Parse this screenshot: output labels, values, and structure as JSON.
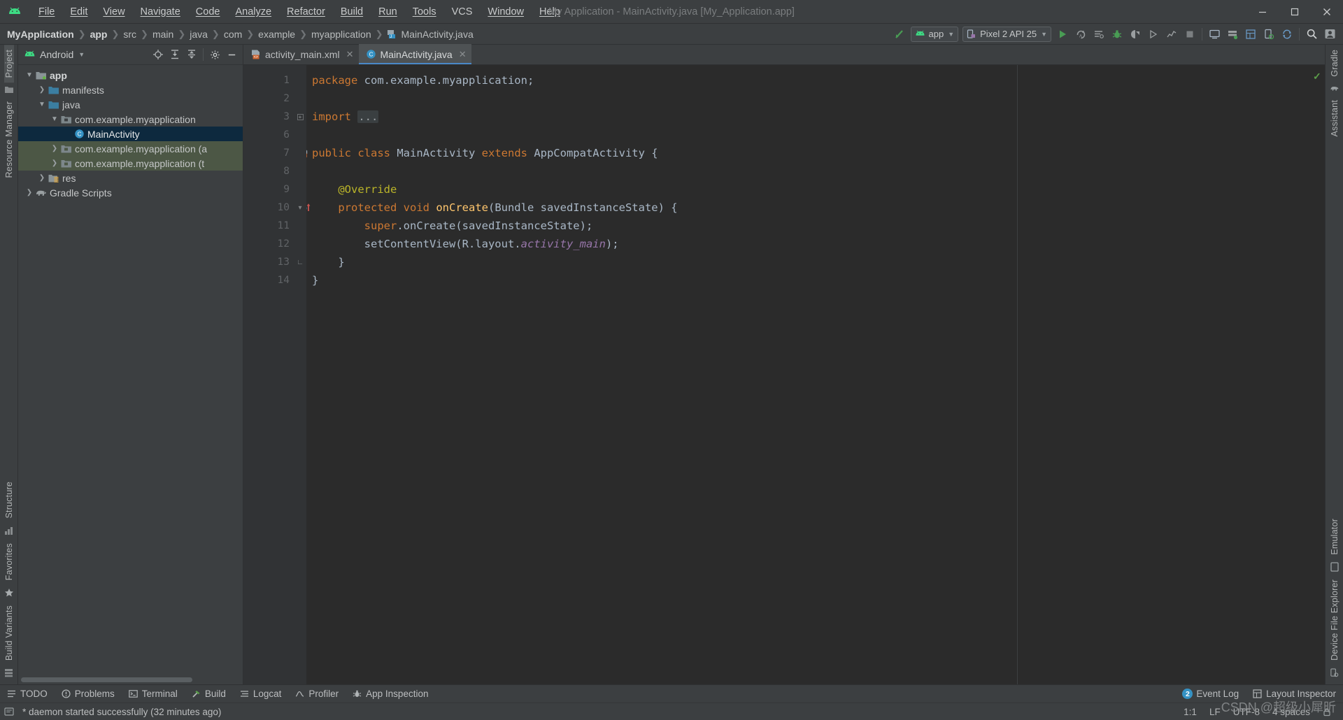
{
  "window": {
    "title": "My Application - MainActivity.java [My_Application.app]",
    "minimize_label": "—",
    "maximize_label": "❐",
    "close_label": "✕"
  },
  "menu": {
    "items": [
      {
        "label": "File",
        "mnemonic": "F"
      },
      {
        "label": "Edit",
        "mnemonic": "E"
      },
      {
        "label": "View",
        "mnemonic": "V"
      },
      {
        "label": "Navigate",
        "mnemonic": "N"
      },
      {
        "label": "Code",
        "mnemonic": "C"
      },
      {
        "label": "Analyze",
        "mnemonic": "z"
      },
      {
        "label": "Refactor",
        "mnemonic": "R"
      },
      {
        "label": "Build",
        "mnemonic": "B"
      },
      {
        "label": "Run",
        "mnemonic": "u"
      },
      {
        "label": "Tools",
        "mnemonic": "T"
      },
      {
        "label": "VCS",
        "mnemonic": ""
      },
      {
        "label": "Window",
        "mnemonic": "W"
      },
      {
        "label": "Help",
        "mnemonic": "H"
      }
    ]
  },
  "breadcrumbs": [
    {
      "label": "MyApplication",
      "bold": true
    },
    {
      "label": "app",
      "bold": true
    },
    {
      "label": "src",
      "bold": false
    },
    {
      "label": "main",
      "bold": false
    },
    {
      "label": "java",
      "bold": false
    },
    {
      "label": "com",
      "bold": false
    },
    {
      "label": "example",
      "bold": false
    },
    {
      "label": "myapplication",
      "bold": false
    },
    {
      "label": "MainActivity.java",
      "bold": false,
      "icon": "java-class-icon"
    }
  ],
  "toolbar": {
    "module_selector": "app",
    "device_selector": "Pixel 2 API 25",
    "icons": [
      {
        "name": "make-project-icon",
        "glyph": "build"
      },
      {
        "name": "run-icon",
        "glyph": "play"
      },
      {
        "name": "apply-changes-icon",
        "glyph": "apply"
      },
      {
        "name": "apply-code-changes-icon",
        "glyph": "applycode"
      },
      {
        "name": "debug-icon",
        "glyph": "bug"
      },
      {
        "name": "attach-debugger-icon",
        "glyph": "attach"
      },
      {
        "name": "run-with-coverage-icon",
        "glyph": "coverage"
      },
      {
        "name": "profile-icon",
        "glyph": "profile"
      },
      {
        "name": "stop-icon",
        "glyph": "stop"
      },
      {
        "name": "avd-manager-icon",
        "glyph": "avd"
      },
      {
        "name": "sdk-manager-icon",
        "glyph": "sdk"
      },
      {
        "name": "layout-inspector-icon",
        "glyph": "layout"
      },
      {
        "name": "device-file-explorer-icon",
        "glyph": "devfile"
      },
      {
        "name": "sync-gradle-icon",
        "glyph": "sync"
      },
      {
        "name": "search-everywhere-icon",
        "glyph": "search"
      },
      {
        "name": "account-icon",
        "glyph": "account"
      }
    ]
  },
  "left_strip": {
    "top": [
      {
        "label": "Project",
        "selected": true
      },
      {
        "label": "Resource Manager",
        "selected": false
      }
    ],
    "bottom": [
      {
        "label": "Structure",
        "selected": false
      },
      {
        "label": "Favorites",
        "selected": false
      },
      {
        "label": "Build Variants",
        "selected": false
      }
    ]
  },
  "right_strip": {
    "top": [
      {
        "label": "Gradle",
        "selected": false
      },
      {
        "label": "Assistant",
        "selected": false
      }
    ],
    "bottom": [
      {
        "label": "Emulator",
        "selected": false
      },
      {
        "label": "Device File Explorer",
        "selected": false
      }
    ]
  },
  "project_panel": {
    "view_name": "Android",
    "header_icons": [
      {
        "name": "select-opened-file-icon"
      },
      {
        "name": "expand-all-icon"
      },
      {
        "name": "collapse-all-icon"
      },
      {
        "name": "settings-gear-icon"
      },
      {
        "name": "hide-panel-icon"
      }
    ],
    "tree": [
      {
        "label": "app",
        "depth": 0,
        "arrow": "down",
        "icon": "module-folder-icon",
        "bold": true,
        "state": "normal"
      },
      {
        "label": "manifests",
        "depth": 1,
        "arrow": "right",
        "icon": "folder-icon",
        "bold": false,
        "state": "normal"
      },
      {
        "label": "java",
        "depth": 1,
        "arrow": "down",
        "icon": "folder-icon",
        "bold": false,
        "state": "normal"
      },
      {
        "label": "com.example.myapplication",
        "depth": 2,
        "arrow": "down",
        "icon": "package-icon",
        "bold": false,
        "state": "normal"
      },
      {
        "label": "MainActivity",
        "depth": 3,
        "arrow": "none",
        "icon": "java-class-circle-icon",
        "bold": false,
        "state": "selected"
      },
      {
        "label": "com.example.myapplication (a",
        "depth": 2,
        "arrow": "right",
        "icon": "package-icon",
        "bold": false,
        "state": "green"
      },
      {
        "label": "com.example.myapplication (t",
        "depth": 2,
        "arrow": "right",
        "icon": "package-icon",
        "bold": false,
        "state": "green"
      },
      {
        "label": "res",
        "depth": 1,
        "arrow": "right",
        "icon": "res-folder-icon",
        "bold": false,
        "state": "normal"
      },
      {
        "label": "Gradle Scripts",
        "depth": 0,
        "arrow": "right",
        "icon": "gradle-elephant-icon",
        "bold": false,
        "state": "normal"
      }
    ]
  },
  "editor": {
    "tabs": [
      {
        "label": "activity_main.xml",
        "icon": "xml-layout-icon",
        "active": false,
        "close": "✕"
      },
      {
        "label": "MainActivity.java",
        "icon": "java-class-circle-icon",
        "active": true,
        "close": "✕"
      }
    ],
    "inspection_status": "✓",
    "lines": [
      {
        "num": "1",
        "gutter": "",
        "fold": "",
        "tokens": [
          {
            "t": "package ",
            "c": "kw"
          },
          {
            "t": "com.example.myapplication",
            "c": "pl"
          },
          {
            "t": ";",
            "c": "pl"
          }
        ]
      },
      {
        "num": "2",
        "gutter": "",
        "fold": "",
        "tokens": []
      },
      {
        "num": "3",
        "gutter": "",
        "fold": "plus",
        "tokens": [
          {
            "t": "import ",
            "c": "kw"
          },
          {
            "t": "...",
            "c": "folded"
          }
        ]
      },
      {
        "num": "6",
        "gutter": "",
        "fold": "",
        "tokens": []
      },
      {
        "num": "7",
        "gutter": "class-marker",
        "fold": "",
        "tokens": [
          {
            "t": "public ",
            "c": "kw"
          },
          {
            "t": "class ",
            "c": "kw"
          },
          {
            "t": "MainActivity ",
            "c": "pl"
          },
          {
            "t": "extends ",
            "c": "kw"
          },
          {
            "t": "AppCompatActivity {",
            "c": "pl"
          }
        ]
      },
      {
        "num": "8",
        "gutter": "",
        "fold": "",
        "tokens": []
      },
      {
        "num": "9",
        "gutter": "",
        "fold": "",
        "tokens": [
          {
            "t": "    @Override",
            "c": "an"
          }
        ]
      },
      {
        "num": "10",
        "gutter": "override-marker",
        "fold": "collapse",
        "tokens": [
          {
            "t": "    protected ",
            "c": "kw"
          },
          {
            "t": "void ",
            "c": "kw"
          },
          {
            "t": "onCreate",
            "c": "fn"
          },
          {
            "t": "(Bundle savedInstanceState) {",
            "c": "pl"
          }
        ]
      },
      {
        "num": "11",
        "gutter": "",
        "fold": "",
        "tokens": [
          {
            "t": "        super",
            "c": "kw"
          },
          {
            "t": ".onCreate(savedInstanceState);",
            "c": "pl"
          }
        ]
      },
      {
        "num": "12",
        "gutter": "",
        "fold": "",
        "tokens": [
          {
            "t": "        setContentView(R.layout.",
            "c": "pl"
          },
          {
            "t": "activity_main",
            "c": "fld"
          },
          {
            "t": ");",
            "c": "pl"
          }
        ]
      },
      {
        "num": "13",
        "gutter": "",
        "fold": "end",
        "tokens": [
          {
            "t": "    }",
            "c": "pl"
          }
        ]
      },
      {
        "num": "14",
        "gutter": "",
        "fold": "",
        "tokens": [
          {
            "t": "}",
            "c": "pl"
          }
        ]
      }
    ]
  },
  "bottom_bar": {
    "left_items": [
      {
        "label": "TODO",
        "icon": "todo-icon"
      },
      {
        "label": "Problems",
        "icon": "problems-icon"
      },
      {
        "label": "Terminal",
        "icon": "terminal-icon"
      },
      {
        "label": "Build",
        "icon": "build-hammer-icon"
      },
      {
        "label": "Logcat",
        "icon": "logcat-icon"
      },
      {
        "label": "Profiler",
        "icon": "profiler-icon"
      },
      {
        "label": "App Inspection",
        "icon": "app-inspection-icon"
      }
    ],
    "right_items": [
      {
        "label": "Event Log",
        "icon": "event-log-icon",
        "badge": "2"
      },
      {
        "label": "Layout Inspector",
        "icon": "layout-inspector-icon",
        "badge": ""
      }
    ]
  },
  "status_bar": {
    "message": "* daemon started successfully (32 minutes ago)",
    "caret_position": "1:1",
    "line_separator": "LF",
    "encoding": "UTF-8",
    "indent": "4 spaces"
  },
  "watermark": "CSDN @超级小犀昕",
  "colors": {
    "chrome": "#3c3f41",
    "editor_bg": "#2b2b2b",
    "gutter_bg": "#313335",
    "selection_blue": "#0d293e",
    "tree_green": "#4c5745",
    "accent_green": "#499c54",
    "tab_active": "#4e5254",
    "keyword_orange": "#cc7832",
    "plain_text": "#a9b7c6",
    "annotation_yellow": "#bbb529",
    "method_yellow": "#ffc66d",
    "field_purple": "#9876aa"
  }
}
